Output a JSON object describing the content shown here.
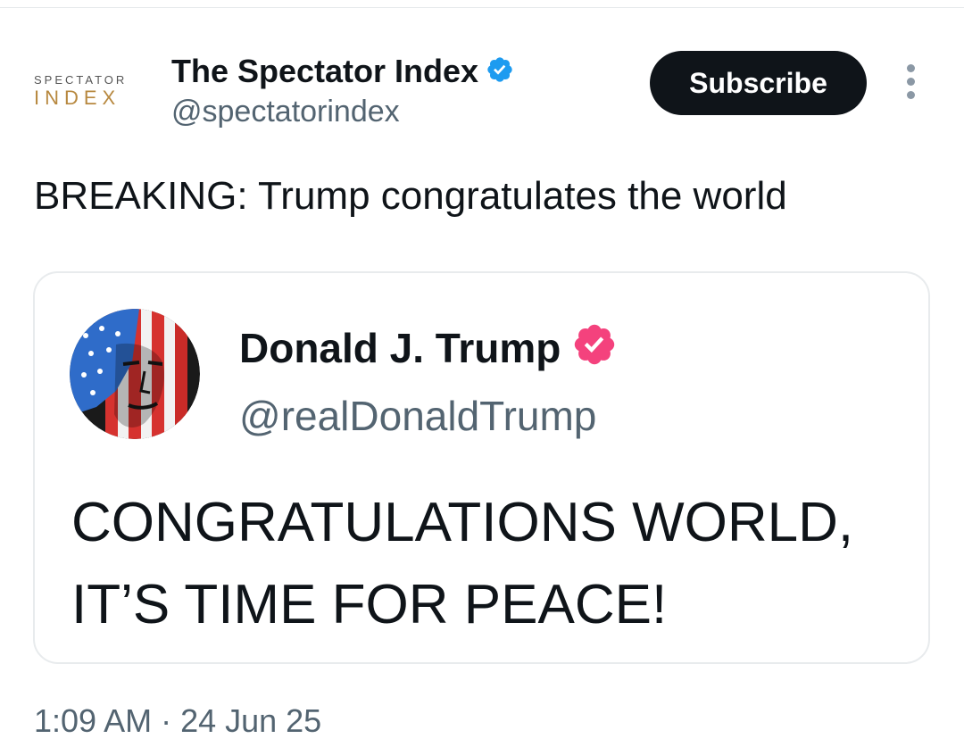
{
  "colors": {
    "text_primary": "#0f1419",
    "text_secondary": "#536471",
    "verified_blue": "#1d9bf0",
    "verified_pink": "#f4427d",
    "subscribe_bg": "#0f1419",
    "logo_gold": "#b7883f"
  },
  "author": {
    "logo_line1": "SPECTATOR",
    "logo_line2": "INDEX",
    "name": "The Spectator Index",
    "handle": "@spectatorindex",
    "verified_icon": "verified-badge-icon"
  },
  "actions": {
    "subscribe_label": "Subscribe",
    "more_icon": "more-options-icon"
  },
  "tweet": {
    "text": "BREAKING: Trump congratulates the world"
  },
  "quoted": {
    "name": "Donald J. Trump",
    "handle": "@realDonaldTrump",
    "badge_icon": "verified-badge-icon",
    "body_line1": "CONGRATULATIONS WORLD,",
    "body_line2": "IT’S TIME FOR PEACE!"
  },
  "meta": {
    "timestamp": "1:09 AM · 24 Jun 25"
  }
}
